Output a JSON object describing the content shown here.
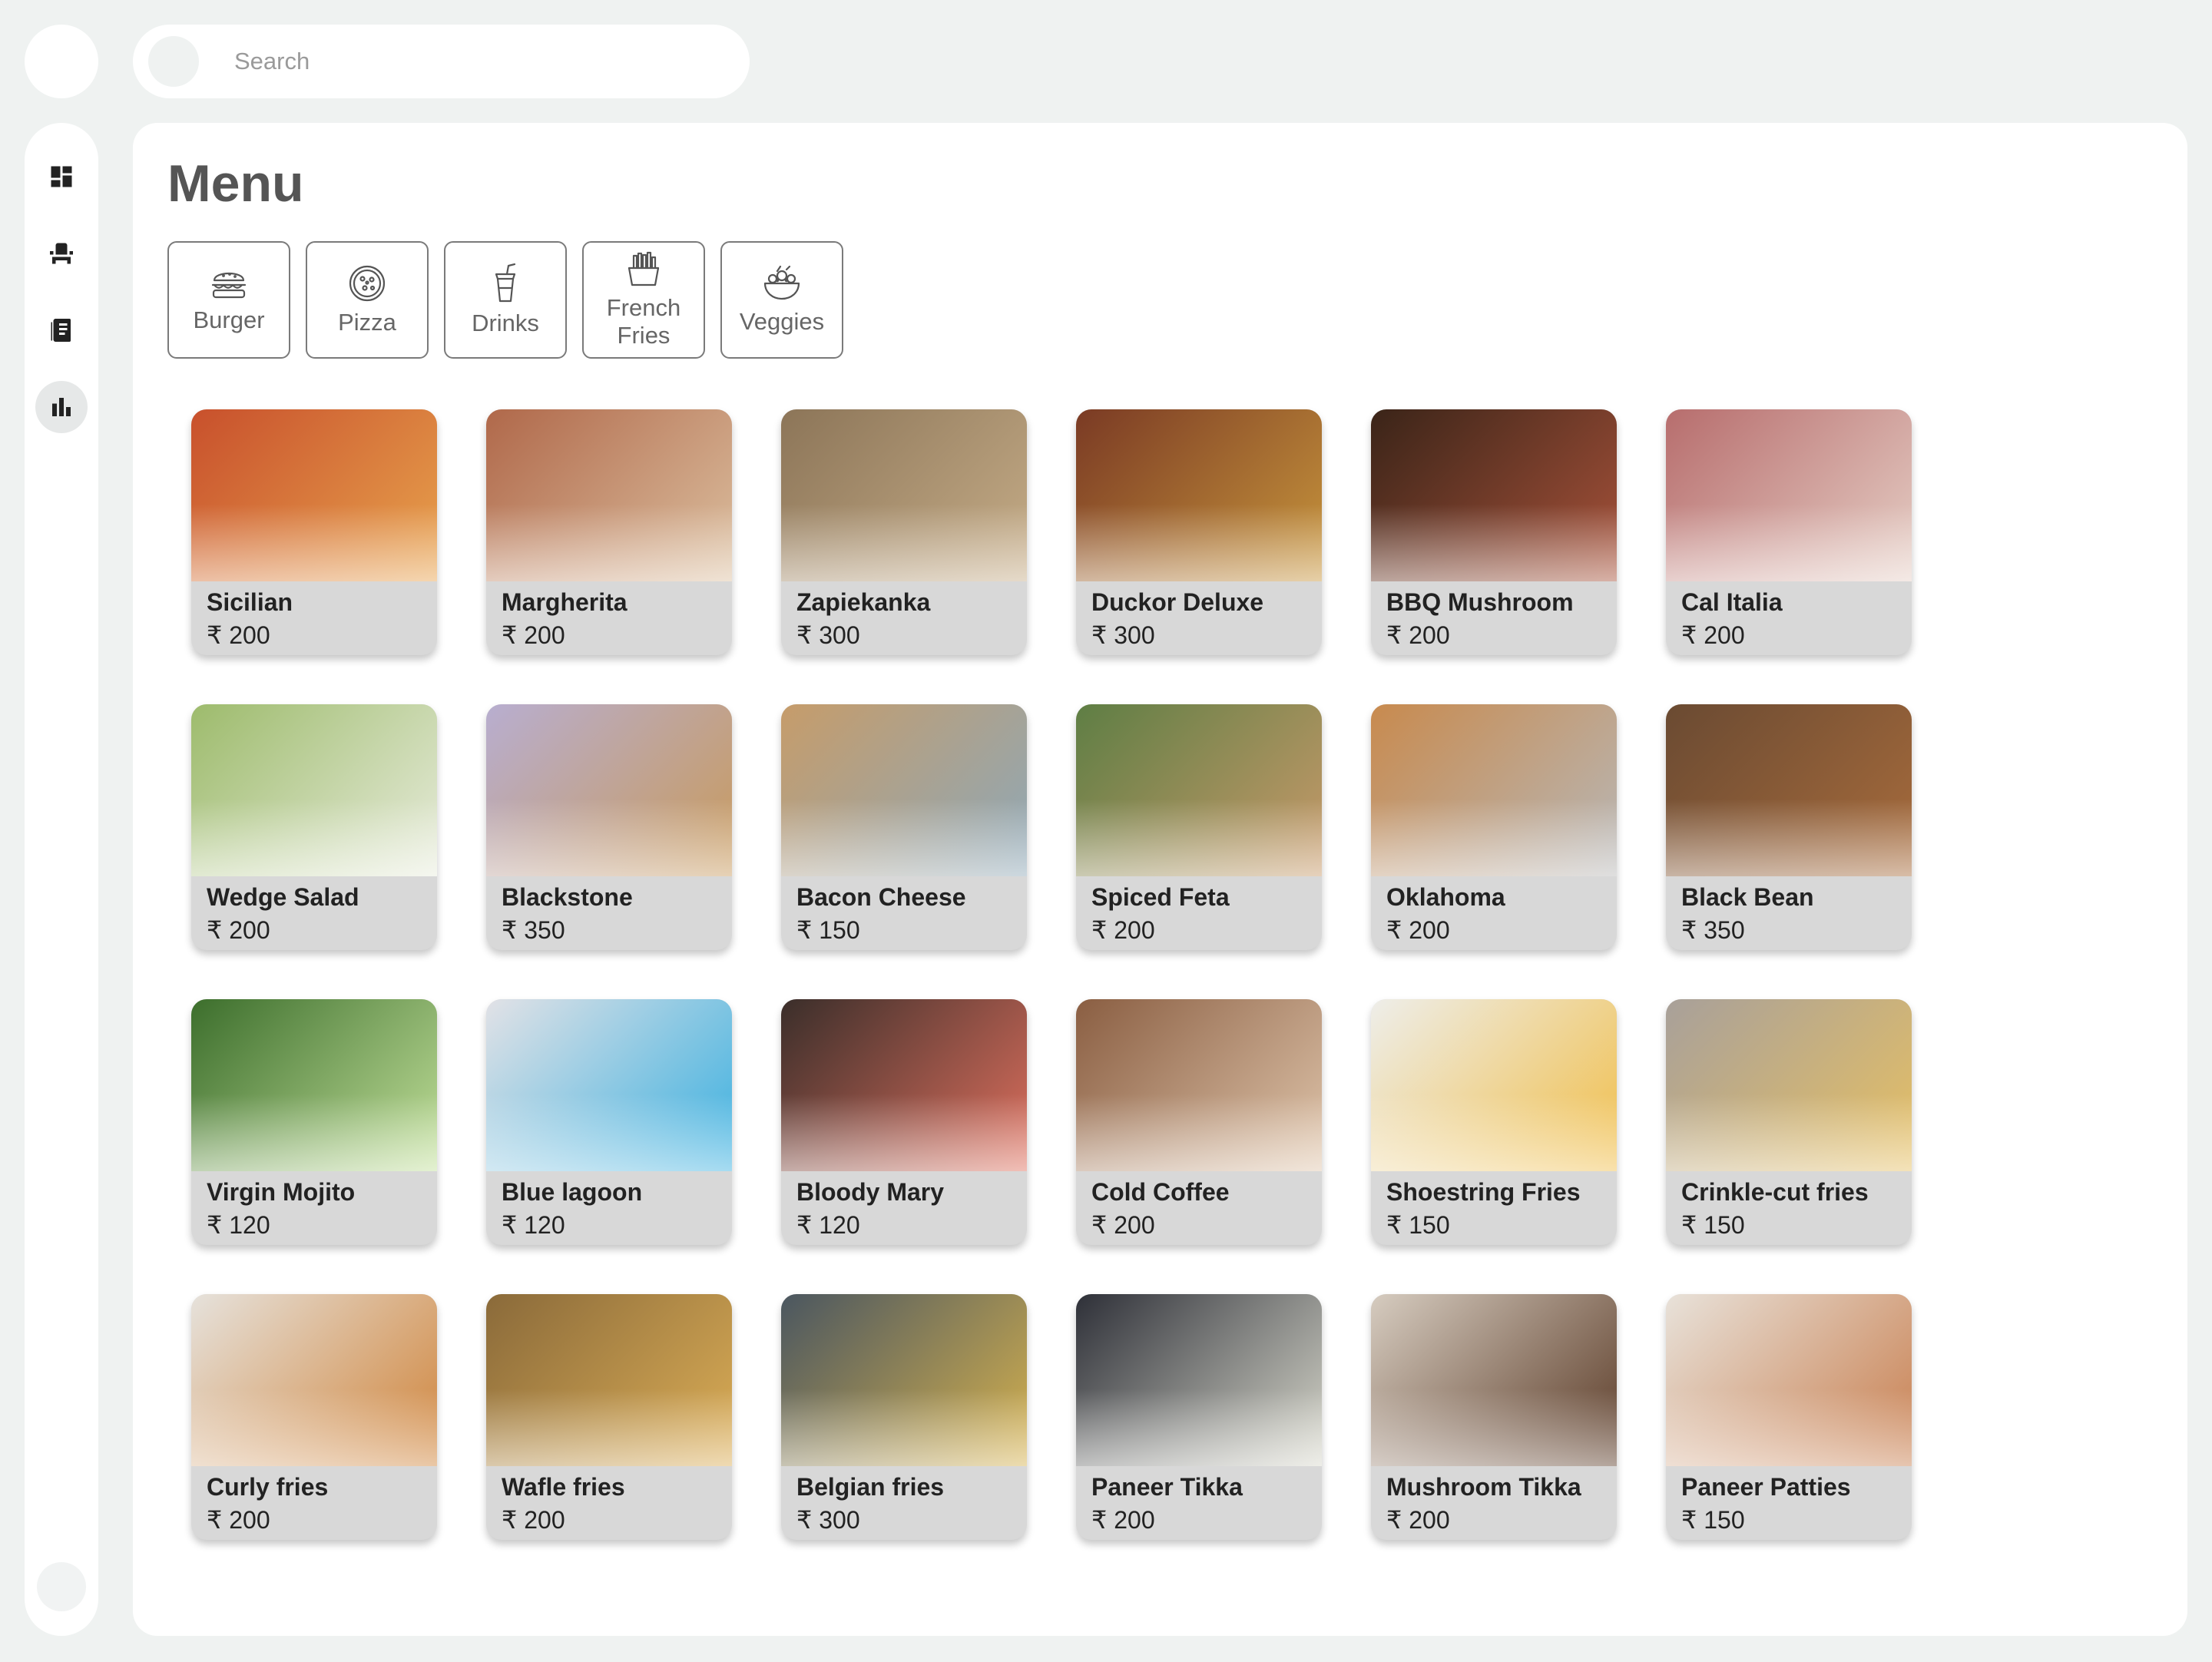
{
  "search": {
    "placeholder": "Search"
  },
  "sidebar": {
    "items": [
      {
        "icon": "dashboard-icon",
        "active": false
      },
      {
        "icon": "seat-icon",
        "active": false
      },
      {
        "icon": "menu-book-icon",
        "active": false
      },
      {
        "icon": "bar-chart-icon",
        "active": true
      }
    ]
  },
  "page": {
    "title": "Menu"
  },
  "categories": [
    {
      "label": "Burger",
      "icon": "burger-icon"
    },
    {
      "label": "Pizza",
      "icon": "pizza-icon"
    },
    {
      "label": "Drinks",
      "icon": "drink-icon"
    },
    {
      "label": "French Fries",
      "icon": "fries-icon"
    },
    {
      "label": "Veggies",
      "icon": "salad-bowl-icon"
    }
  ],
  "currency": "₹",
  "items": [
    {
      "name": "Sicilian",
      "price": "200",
      "colors": [
        "#c8502c",
        "#e8a34d"
      ]
    },
    {
      "name": "Margherita",
      "price": "200",
      "colors": [
        "#b0684a",
        "#dcc0a0"
      ]
    },
    {
      "name": "Zapiekanka",
      "price": "300",
      "colors": [
        "#8c7558",
        "#c6ad88"
      ]
    },
    {
      "name": "Duckor Deluxe",
      "price": "300",
      "colors": [
        "#7a3a24",
        "#c8963c"
      ]
    },
    {
      "name": "BBQ Mushroom",
      "price": "200",
      "colors": [
        "#3a2418",
        "#a8523a"
      ]
    },
    {
      "name": "Cal Italia",
      "price": "200",
      "colors": [
        "#b76d6d",
        "#e6cfc6"
      ]
    },
    {
      "name": "Wedge Salad",
      "price": "200",
      "colors": [
        "#9dbb6c",
        "#e8ecdc"
      ]
    },
    {
      "name": "Blackstone",
      "price": "350",
      "colors": [
        "#b8aed0",
        "#c89a5c"
      ]
    },
    {
      "name": "Bacon Cheese",
      "price": "150",
      "colors": [
        "#c69c6a",
        "#8ea8b8"
      ]
    },
    {
      "name": "Spiced Feta",
      "price": "200",
      "colors": [
        "#5e7e44",
        "#c89a6a"
      ]
    },
    {
      "name": "Oklahoma",
      "price": "200",
      "colors": [
        "#c88a4e",
        "#b8b8b8"
      ]
    },
    {
      "name": "Black Bean",
      "price": "350",
      "colors": [
        "#6a4a32",
        "#a86c3c"
      ]
    },
    {
      "name": "Virgin Mojito",
      "price": "120",
      "colors": [
        "#3c6e2c",
        "#c2e09a"
      ]
    },
    {
      "name": "Blue lagoon",
      "price": "120",
      "colors": [
        "#e2e2e6",
        "#3ab0e0"
      ]
    },
    {
      "name": "Bloody Mary",
      "price": "120",
      "colors": [
        "#3a2e2a",
        "#e0705e"
      ]
    },
    {
      "name": "Cold Coffee",
      "price": "200",
      "colors": [
        "#8a5e42",
        "#e0c6ac"
      ]
    },
    {
      "name": "Shoestring Fries",
      "price": "150",
      "colors": [
        "#eeeeea",
        "#f0be4a"
      ]
    },
    {
      "name": "Crinkle-cut fries",
      "price": "150",
      "colors": [
        "#a8a09a",
        "#e6c064"
      ]
    },
    {
      "name": "Curly fries",
      "price": "200",
      "colors": [
        "#e6e2dc",
        "#d0843a"
      ]
    },
    {
      "name": "Wafle fries",
      "price": "200",
      "colors": [
        "#8a6a3a",
        "#dcae56"
      ]
    },
    {
      "name": "Belgian fries",
      "price": "300",
      "colors": [
        "#4a5660",
        "#d6b24e"
      ]
    },
    {
      "name": "Paneer Tikka",
      "price": "200",
      "colors": [
        "#2e3038",
        "#d8d8cc"
      ]
    },
    {
      "name": "Mushroom Tikka",
      "price": "200",
      "colors": [
        "#d6ccc0",
        "#5a3a26"
      ]
    },
    {
      "name": "Paneer Patties",
      "price": "150",
      "colors": [
        "#e8e2da",
        "#c87e4e"
      ]
    }
  ]
}
